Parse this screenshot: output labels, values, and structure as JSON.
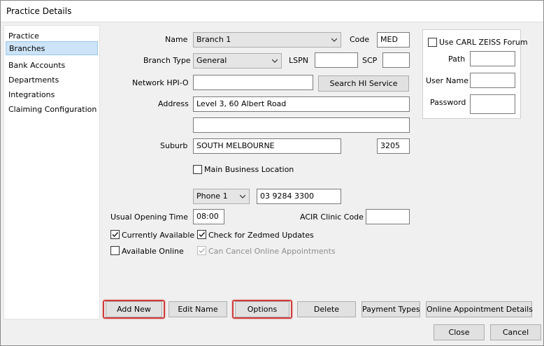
{
  "window": {
    "title": "Practice Details"
  },
  "sidebar": {
    "items": [
      {
        "label": "Practice"
      },
      {
        "label": "Branches"
      },
      {
        "label": "Bank Accounts"
      },
      {
        "label": "Departments"
      },
      {
        "label": "Integrations"
      },
      {
        "label": "Claiming Configuration"
      }
    ]
  },
  "form": {
    "name_label": "Name",
    "name_value": "Branch 1",
    "code_label": "Code",
    "code_value": "MED",
    "branch_type_label": "Branch Type",
    "branch_type_value": "General",
    "lspn_label": "LSPN",
    "lspn_value": "",
    "scp_label": "SCP",
    "scp_value": "",
    "network_hpio_label": "Network HPI-O",
    "network_hpio_value": "",
    "search_hi_label": "Search HI Service",
    "address_label": "Address",
    "address_line1": "Level 3, 60 Albert Road",
    "address_line2": "",
    "suburb_label": "Suburb",
    "suburb_value": "SOUTH MELBOURNE",
    "postcode_value": "3205",
    "main_business_label": "Main Business Location",
    "main_business_checked": false,
    "phone_type_value": "Phone 1",
    "phone_value": "03 9284 3300",
    "opening_time_label": "Usual Opening Time",
    "opening_time_value": "08:00",
    "acir_label": "ACIR Clinic Code",
    "acir_value": "",
    "currently_available_label": "Currently Available",
    "currently_available_checked": true,
    "zedmed_updates_label": "Check for Zedmed Updates",
    "zedmed_updates_checked": true,
    "available_online_label": "Available Online",
    "available_online_checked": false,
    "cancel_online_label": "Can Cancel Online Appointments",
    "cancel_online_checked": true
  },
  "forum": {
    "use_label": "Use CARL ZEISS Forum",
    "use_checked": false,
    "path_label": "Path",
    "path_value": "",
    "username_label": "User Name",
    "username_value": "",
    "password_label": "Password",
    "password_value": ""
  },
  "actions": {
    "add_new": "Add New",
    "edit_name": "Edit Name",
    "options": "Options",
    "delete": "Delete",
    "payment_types": "Payment Types",
    "online_appointment_details": "Online Appointment Details"
  },
  "footer": {
    "close": "Close",
    "cancel": "Cancel"
  },
  "colors": {
    "selected_bg": "#cde3f7",
    "highlight": "#d03a3a"
  }
}
